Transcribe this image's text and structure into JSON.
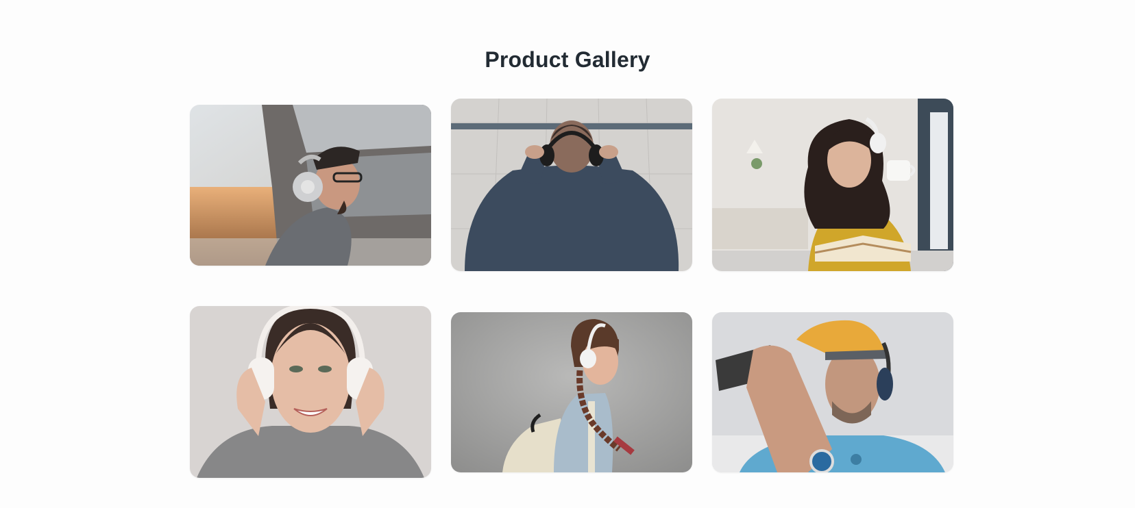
{
  "gallery": {
    "title": "Product Gallery",
    "items": [
      {
        "subject": "man-with-cap-and-glasses-wearing-headphones-photo"
      },
      {
        "subject": "man-from-behind-adjusting-headphones-photo"
      },
      {
        "subject": "woman-with-coffee-and-book-wearing-headphones-photo"
      },
      {
        "subject": "smiling-woman-holding-headphones-photo"
      },
      {
        "subject": "girl-with-braid-and-backpack-wearing-headphones-photo"
      },
      {
        "subject": "man-in-yellow-cap-with-phone-wearing-headphones-photo"
      }
    ]
  },
  "colors": {
    "background": "#fdfdfd",
    "title": "#222b33"
  }
}
